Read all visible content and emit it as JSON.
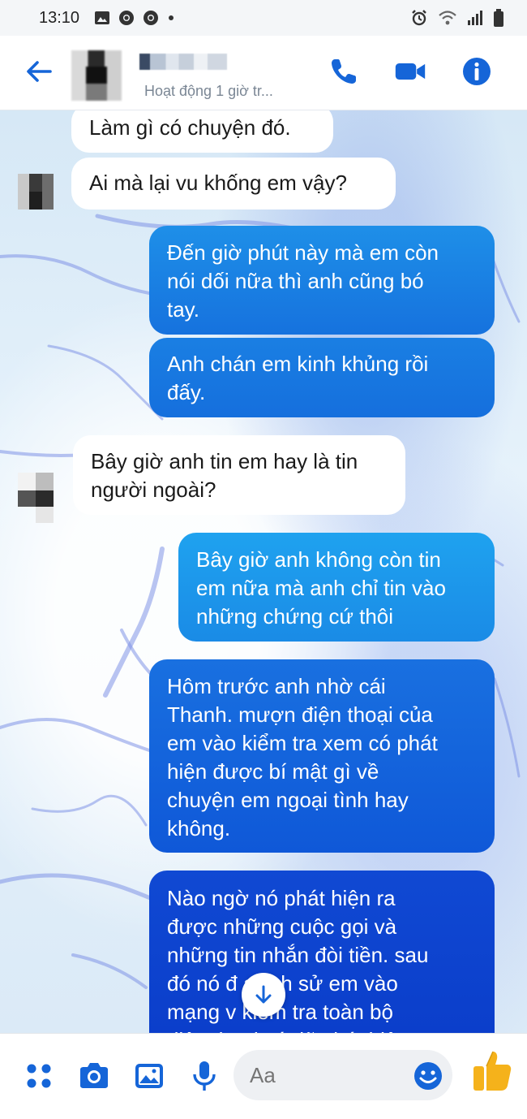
{
  "status_bar": {
    "time": "13:10",
    "notification_icons": [
      "image-icon",
      "chrome-icon",
      "chrome-icon",
      "dot"
    ],
    "right_icons": [
      "alarm-icon",
      "wifi-icon",
      "signal-icon",
      "battery-icon"
    ]
  },
  "header": {
    "subtitle": "Hoạt động 1 giờ tr...",
    "accent_color": "#1565d8"
  },
  "messages": [
    {
      "side": "in",
      "text": "Làm gì có chuyện đó."
    },
    {
      "side": "in",
      "text": "Ai mà lại vu khống em vậy?"
    },
    {
      "side": "out",
      "text": "Đến giờ phút này mà em còn\nnói dối nữa thì anh cũng bó\ntay."
    },
    {
      "side": "out",
      "text": "Anh chán em kinh khủng rồi\nđấy."
    },
    {
      "side": "in",
      "text": "Bây giờ anh tin em hay là tin\nngười ngoài?"
    },
    {
      "side": "out",
      "text": "Bây giờ anh không còn tin\nem nữa mà anh chỉ tin vào\nnhững chứng cứ thôi"
    },
    {
      "side": "out",
      "text": "Hôm trước anh nhờ cái\nThanh. mượn điện thoại của\nem vào kiểm tra xem có phát\nhiện được bí mật gì về\nchuyện em ngoại tình hay\nkhông."
    },
    {
      "side": "out",
      "text": "Nào ngờ nó phát hiện ra\nđược những cuộc gọi và\nnhững tin nhắn đòi tiền. sau\nđó nó đ    a lịch sử em vào\nmạng v    kiểm tra toàn bộ\nđiện thoại có đã phát hiện"
    }
  ],
  "composer": {
    "placeholder": "Aa",
    "icons": [
      "apps-icon",
      "camera-icon",
      "gallery-icon",
      "microphone-icon",
      "emoji-icon",
      "thumbs-up-icon"
    ]
  },
  "colors": {
    "out_bubble_top": "#1e8fe8",
    "out_bubble_bottom": "#0b3fd1",
    "thumbs_up": "#f5b21b"
  }
}
